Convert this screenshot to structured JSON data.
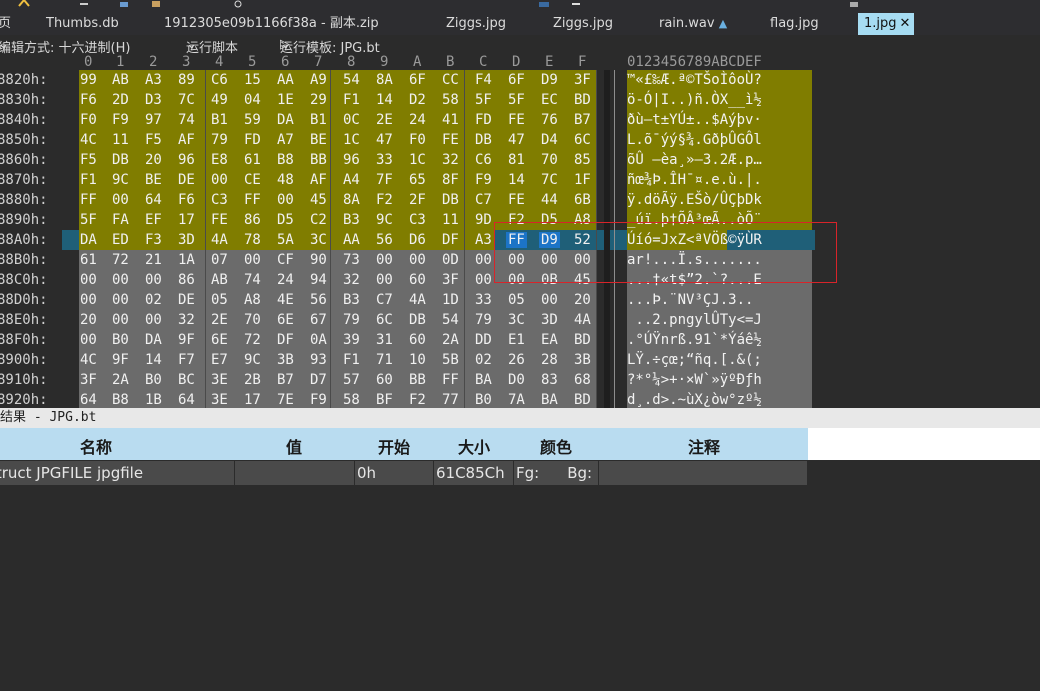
{
  "tabs": [
    {
      "label": "页",
      "active": false
    },
    {
      "label": "Thumbs.db",
      "active": false
    },
    {
      "label": "1912305e09b1166f38a - 副本.zip",
      "active": false
    },
    {
      "label": "Ziggs.jpg",
      "active": false
    },
    {
      "label": "Ziggs.jpg",
      "active": false
    },
    {
      "label": "rain.wav",
      "active": false,
      "icon": "lock-icon"
    },
    {
      "label": "flag.jpg",
      "active": false
    },
    {
      "label": "1.jpg",
      "active": true
    }
  ],
  "options": {
    "edit_mode": "编辑方式: 十六进制(H)",
    "run_script": "运行脚本",
    "run_template": "运行模板: JPG.bt"
  },
  "columns": {
    "hex": [
      "0",
      "1",
      "2",
      "3",
      "4",
      "5",
      "6",
      "7",
      "8",
      "9",
      "A",
      "B",
      "C",
      "D",
      "E",
      "F"
    ],
    "ascii": "0123456789ABCDEF"
  },
  "rows": [
    {
      "addr": "8820h:",
      "bytes": [
        "99",
        "AB",
        "A3",
        "89",
        "C6",
        "15",
        "AA",
        "A9",
        "54",
        "8A",
        "6F",
        "CC",
        "F4",
        "6F",
        "D9",
        "3F"
      ],
      "ascii": "™«£‰Æ.ª©TŠoÌôoÙ?"
    },
    {
      "addr": "8830h:",
      "bytes": [
        "F6",
        "2D",
        "D3",
        "7C",
        "49",
        "04",
        "1E",
        "29",
        "F1",
        "14",
        "D2",
        "58",
        "5F",
        "5F",
        "EC",
        "BD"
      ],
      "ascii": "ö-Ó|I..)ñ.ÒX__ì½"
    },
    {
      "addr": "8840h:",
      "bytes": [
        "F0",
        "F9",
        "97",
        "74",
        "B1",
        "59",
        "DA",
        "B1",
        "0C",
        "2E",
        "24",
        "41",
        "FD",
        "FE",
        "76",
        "B7"
      ],
      "ascii": "ðù—t±YÚ±..$Aýþv·"
    },
    {
      "addr": "8850h:",
      "bytes": [
        "4C",
        "11",
        "F5",
        "AF",
        "79",
        "FD",
        "A7",
        "BE",
        "1C",
        "47",
        "F0",
        "FE",
        "DB",
        "47",
        "D4",
        "6C"
      ],
      "ascii": "L.õ¯ýý§¾.GðþÛGÔl"
    },
    {
      "addr": "8860h:",
      "bytes": [
        "F5",
        "DB",
        "20",
        "96",
        "E8",
        "61",
        "B8",
        "BB",
        "96",
        "33",
        "1C",
        "32",
        "C6",
        "81",
        "70",
        "85"
      ],
      "ascii": "õÛ –èa¸»–3.2Æ.p…"
    },
    {
      "addr": "8870h:",
      "bytes": [
        "F1",
        "9C",
        "BE",
        "DE",
        "00",
        "CE",
        "48",
        "AF",
        "A4",
        "7F",
        "65",
        "8F",
        "F9",
        "14",
        "7C",
        "1F"
      ],
      "ascii": "ñœ¾Þ.ÎH¯¤.e.ù.|."
    },
    {
      "addr": "8880h:",
      "bytes": [
        "FF",
        "00",
        "64",
        "F6",
        "C3",
        "FF",
        "00",
        "45",
        "8A",
        "F2",
        "2F",
        "DB",
        "C7",
        "FE",
        "44",
        "6B"
      ],
      "ascii": "ÿ.döÃÿ.EŠò/ÛÇþDk"
    },
    {
      "addr": "8890h:",
      "bytes": [
        "5F",
        "FA",
        "EF",
        "17",
        "FE",
        "86",
        "D5",
        "C2",
        "B3",
        "9C",
        "C3",
        "11",
        "9D",
        "F2",
        "D5",
        "A8"
      ],
      "ascii": "_úï.þ†ÕÂ³œÃ..òÕ¨"
    },
    {
      "addr": "88A0h:",
      "bytes": [
        "DA",
        "ED",
        "F3",
        "3D",
        "4A",
        "78",
        "5A",
        "3C",
        "AA",
        "56",
        "D6",
        "DF",
        "A3",
        "FF",
        "D9",
        "52"
      ],
      "ascii": "Úíó=JxZ<ªVÖß©ÿÙR"
    },
    {
      "addr": "88B0h:",
      "bytes": [
        "61",
        "72",
        "21",
        "1A",
        "07",
        "00",
        "CF",
        "90",
        "73",
        "00",
        "00",
        "0D",
        "00",
        "00",
        "00",
        "00"
      ],
      "ascii": "ar!...Ï.s......."
    },
    {
      "addr": "88C0h:",
      "bytes": [
        "00",
        "00",
        "00",
        "86",
        "AB",
        "74",
        "24",
        "94",
        "32",
        "00",
        "60",
        "3F",
        "00",
        "00",
        "0B",
        "45"
      ],
      "ascii": "...†«t$”2.`?...E"
    },
    {
      "addr": "88D0h:",
      "bytes": [
        "00",
        "00",
        "02",
        "DE",
        "05",
        "A8",
        "4E",
        "56",
        "B3",
        "C7",
        "4A",
        "1D",
        "33",
        "05",
        "00",
        "20"
      ],
      "ascii": "...Þ.¨NV³ÇJ.3.. "
    },
    {
      "addr": "88E0h:",
      "bytes": [
        "20",
        "00",
        "00",
        "32",
        "2E",
        "70",
        "6E",
        "67",
        "79",
        "6C",
        "DB",
        "54",
        "79",
        "3C",
        "3D",
        "4A"
      ],
      "ascii": " ..2.pngylÛTy<=J"
    },
    {
      "addr": "88F0h:",
      "bytes": [
        "00",
        "B0",
        "DA",
        "9F",
        "6E",
        "72",
        "DF",
        "0A",
        "39",
        "31",
        "60",
        "2A",
        "DD",
        "E1",
        "EA",
        "BD"
      ],
      "ascii": ".°ÚŸnrß.91`*Ýáê½"
    },
    {
      "addr": "8900h:",
      "bytes": [
        "4C",
        "9F",
        "14",
        "F7",
        "E7",
        "9C",
        "3B",
        "93",
        "F1",
        "71",
        "10",
        "5B",
        "02",
        "26",
        "28",
        "3B"
      ],
      "ascii": "LŸ.÷çœ;“ñq.[.&(;"
    },
    {
      "addr": "8910h:",
      "bytes": [
        "3F",
        "2A",
        "B0",
        "BC",
        "3E",
        "2B",
        "B7",
        "D7",
        "57",
        "60",
        "BB",
        "FF",
        "BA",
        "D0",
        "83",
        "68"
      ],
      "ascii": "?*°¼>+·×W`»ÿºÐƒh"
    },
    {
      "addr": "8920h:",
      "bytes": [
        "64",
        "B8",
        "1B",
        "64",
        "3E",
        "17",
        "7E",
        "F9",
        "58",
        "BF",
        "F2",
        "77",
        "B0",
        "7A",
        "BA",
        "BD"
      ],
      "ascii": "d¸.d>.~ùX¿òw°zº½"
    }
  ],
  "colors": {
    "template": "#807d00",
    "data": "#6b6b6b",
    "cursor_row": "#1f5f78",
    "selected": "#1c74c7",
    "selection_box": "#d8242a"
  },
  "results": {
    "title": "结果 - JPG.bt",
    "headers": [
      "名称",
      "值",
      "开始",
      "大小",
      "颜色",
      "注释"
    ],
    "row": {
      "name": "struct JPGFILE jpgfile",
      "value": "",
      "start": "0h",
      "size": "61C85Ch",
      "fg": "Fg:",
      "bg": "Bg:",
      "comment": ""
    }
  }
}
